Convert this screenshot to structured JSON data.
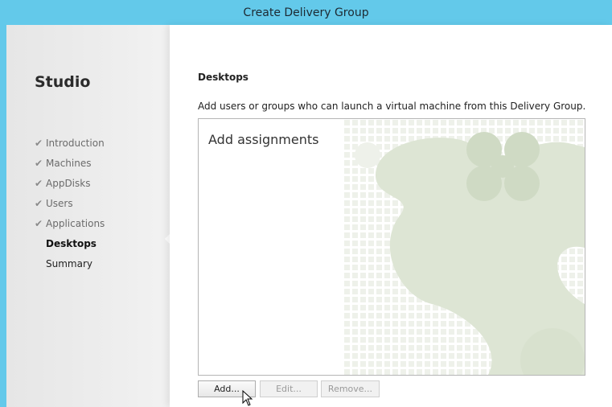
{
  "window": {
    "title": "Create Delivery Group"
  },
  "sidebar": {
    "title": "Studio",
    "steps": [
      {
        "label": "Introduction",
        "state": "done"
      },
      {
        "label": "Machines",
        "state": "done"
      },
      {
        "label": "AppDisks",
        "state": "done"
      },
      {
        "label": "Users",
        "state": "done"
      },
      {
        "label": "Applications",
        "state": "done"
      },
      {
        "label": "Desktops",
        "state": "current"
      },
      {
        "label": "Summary",
        "state": "todo"
      }
    ],
    "check_icon": "checkmark-icon"
  },
  "main": {
    "heading": "Desktops",
    "instruction": "Add users or groups who can launch a virtual machine from this Delivery Group.",
    "panel": {
      "heading": "Add assignments"
    },
    "buttons": {
      "add": "Add...",
      "edit": "Edit...",
      "remove": "Remove..."
    }
  },
  "colors": {
    "titlebar": "#63c9ea",
    "watermark": "#d9e3cf"
  }
}
